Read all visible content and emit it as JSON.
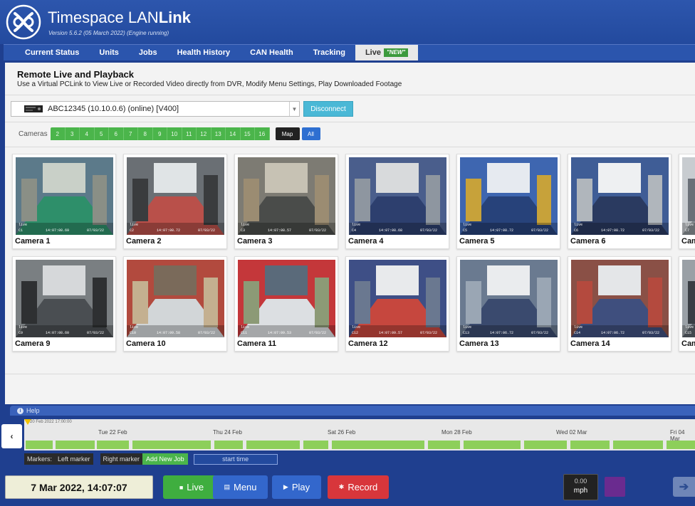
{
  "header": {
    "title_prefix": "Timespace LAN",
    "title_bold": "Link",
    "version": "Version 5.6.2 (05 March 2022) (Engine running)"
  },
  "nav": {
    "tabs": [
      "Current Status",
      "Units",
      "Jobs",
      "Health History",
      "CAN Health",
      "Tracking",
      "Live"
    ],
    "active": "Live",
    "new_badge": "NEW"
  },
  "page": {
    "title": "Remote Live and Playback",
    "subtitle": "Use a Virtual PCLink to View Live or Recorded Video directly from DVR, Modify Menu Settings, Play Downloaded Footage"
  },
  "device": {
    "selected": "ABC12345 (10.10.0.6) (online) [V400]",
    "disconnect_label": "Disconnect"
  },
  "cameras_bar": {
    "label": "Cameras",
    "numbers": [
      "2",
      "3",
      "4",
      "5",
      "6",
      "7",
      "8",
      "9",
      "10",
      "11",
      "12",
      "13",
      "14",
      "15",
      "16"
    ],
    "map_label": "Map",
    "all_label": "All"
  },
  "cameras": [
    {
      "label": "Camera 1",
      "tag": "C1",
      "time": "14:07:08.69",
      "date": "07/03/22"
    },
    {
      "label": "Camera 2",
      "tag": "C2",
      "time": "14:07:08.72",
      "date": "07/03/22"
    },
    {
      "label": "Camera 3",
      "tag": "C3",
      "time": "14:07:08.57",
      "date": "07/03/22"
    },
    {
      "label": "Camera 4",
      "tag": "C4",
      "time": "14:07:08.68",
      "date": "07/03/22"
    },
    {
      "label": "Camera 5",
      "tag": "C5",
      "time": "14:07:08.72",
      "date": "07/03/22"
    },
    {
      "label": "Camera 6",
      "tag": "C6",
      "time": "14:07:08.72",
      "date": "07/03/22"
    },
    {
      "label": "Came",
      "tag": "C7",
      "time": "",
      "date": ""
    },
    {
      "label": "Camera 9",
      "tag": "C9",
      "time": "14:07:08.60",
      "date": "07/03/22"
    },
    {
      "label": "Camera 10",
      "tag": "C10",
      "time": "14:07:09.58",
      "date": "07/03/22"
    },
    {
      "label": "Camera 11",
      "tag": "C11",
      "time": "14:07:09.53",
      "date": "07/03/22"
    },
    {
      "label": "Camera 12",
      "tag": "C12",
      "time": "14:07:09.57",
      "date": "07/03/22"
    },
    {
      "label": "Camera 13",
      "tag": "C13",
      "time": "14:07:06.72",
      "date": "07/03/22"
    },
    {
      "label": "Camera 14",
      "tag": "C14",
      "time": "14:07:06.72",
      "date": "07/03/22"
    },
    {
      "label": "Came",
      "tag": "C15",
      "time": "",
      "date": ""
    }
  ],
  "help": {
    "label": "Help"
  },
  "timeline": {
    "start_label": "20 Feb 2022 17:00:00",
    "dates": [
      "Tue 22 Feb",
      "Thu 24 Feb",
      "Sat 26 Feb",
      "Mon 28 Feb",
      "Wed 02 Mar",
      "Fri 04 Mar"
    ],
    "markers_label": "Markers:",
    "left_marker": "Left marker",
    "right_marker": "Right marker",
    "add_job": "Add New Job",
    "start_time": "start time"
  },
  "controls": {
    "datetime": "7 Mar 2022, 14:07:07",
    "live": "Live",
    "menu": "Menu",
    "play": "Play",
    "record": "Record",
    "speed_value": "0.00",
    "speed_unit": "mph"
  },
  "colors": {
    "header_blue": "#2d56ad",
    "live_green": "#3fae3f",
    "menu_blue": "#3367cc",
    "record_red": "#d8363b",
    "timeline_green": "#8dcf5a"
  }
}
